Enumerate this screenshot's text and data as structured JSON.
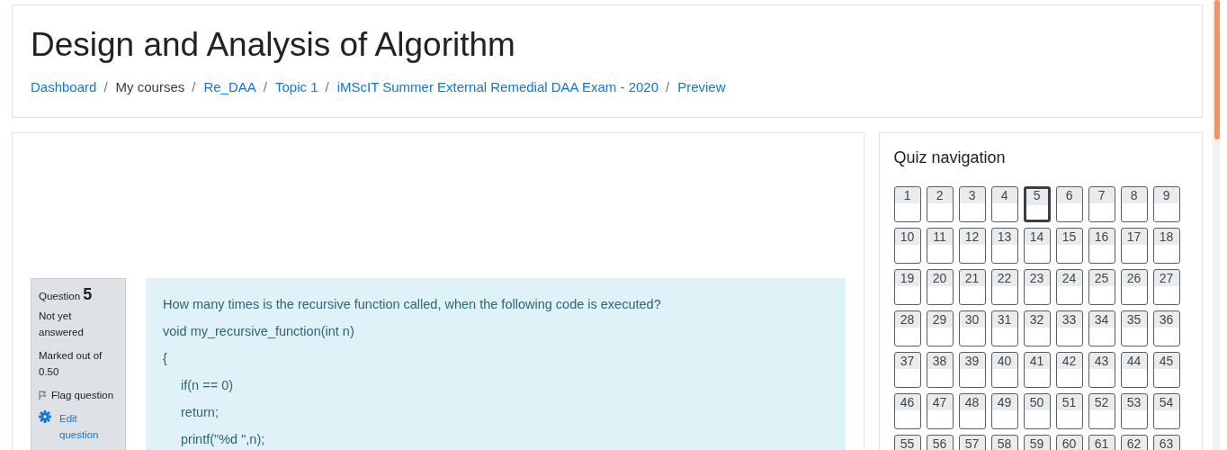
{
  "page_title": "Design and Analysis of Algorithm",
  "breadcrumb": [
    {
      "label": "Dashboard",
      "link": true,
      "separator": "/"
    },
    {
      "label": "My courses",
      "link": false,
      "separator": "/"
    },
    {
      "label": "Re_DAA",
      "link": true,
      "separator": "/"
    },
    {
      "label": "Topic 1",
      "link": true,
      "separator": "/"
    },
    {
      "label": "iMScIT Summer External Remedial DAA Exam - 2020",
      "link": true,
      "separator": "/"
    },
    {
      "label": "Preview",
      "link": true
    }
  ],
  "question_info": {
    "label": "Question",
    "number": "5",
    "state": "Not yet answered",
    "marks": "Marked out of 0.50",
    "flag": "Flag question",
    "edit": "Edit question"
  },
  "question_lines": [
    {
      "text": "How many times is the recursive function called, when the following code is executed?",
      "kind": "prompt"
    },
    {
      "text": "void my_recursive_function(int n)",
      "kind": "code"
    },
    {
      "text": "{",
      "kind": "code"
    },
    {
      "text": "if(n == 0)",
      "kind": "indented"
    },
    {
      "text": "return;",
      "kind": "indented"
    },
    {
      "text": "printf(\"%d \",n);",
      "kind": "indented"
    }
  ],
  "quiz_navigation": {
    "title": "Quiz navigation",
    "buttons": [
      {
        "label": "1",
        "selected": false
      },
      {
        "label": "2",
        "selected": false
      },
      {
        "label": "3",
        "selected": false
      },
      {
        "label": "4",
        "selected": false
      },
      {
        "label": "5",
        "selected": true
      },
      {
        "label": "6",
        "selected": false
      },
      {
        "label": "7",
        "selected": false
      },
      {
        "label": "8",
        "selected": false
      },
      {
        "label": "9",
        "selected": false
      },
      {
        "label": "10",
        "selected": false
      },
      {
        "label": "11",
        "selected": false
      },
      {
        "label": "12",
        "selected": false
      },
      {
        "label": "13",
        "selected": false
      },
      {
        "label": "14",
        "selected": false
      },
      {
        "label": "15",
        "selected": false
      },
      {
        "label": "16",
        "selected": false
      },
      {
        "label": "17",
        "selected": false
      },
      {
        "label": "18",
        "selected": false
      },
      {
        "label": "19",
        "selected": false
      },
      {
        "label": "20",
        "selected": false
      },
      {
        "label": "21",
        "selected": false
      },
      {
        "label": "22",
        "selected": false
      },
      {
        "label": "23",
        "selected": false
      },
      {
        "label": "24",
        "selected": false
      },
      {
        "label": "25",
        "selected": false
      },
      {
        "label": "26",
        "selected": false
      },
      {
        "label": "27",
        "selected": false
      },
      {
        "label": "28",
        "selected": false
      },
      {
        "label": "29",
        "selected": false
      },
      {
        "label": "30",
        "selected": false
      },
      {
        "label": "31",
        "selected": false
      },
      {
        "label": "32",
        "selected": false
      },
      {
        "label": "33",
        "selected": false
      },
      {
        "label": "34",
        "selected": false
      },
      {
        "label": "35",
        "selected": false
      },
      {
        "label": "36",
        "selected": false
      },
      {
        "label": "37",
        "selected": false
      },
      {
        "label": "38",
        "selected": false
      },
      {
        "label": "39",
        "selected": false
      },
      {
        "label": "40",
        "selected": false
      },
      {
        "label": "41",
        "selected": false
      },
      {
        "label": "42",
        "selected": false
      },
      {
        "label": "43",
        "selected": false
      },
      {
        "label": "44",
        "selected": false
      },
      {
        "label": "45",
        "selected": false
      },
      {
        "label": "46",
        "selected": false
      },
      {
        "label": "47",
        "selected": false
      },
      {
        "label": "48",
        "selected": false
      },
      {
        "label": "49",
        "selected": false
      },
      {
        "label": "50",
        "selected": false
      },
      {
        "label": "51",
        "selected": false
      },
      {
        "label": "52",
        "selected": false
      },
      {
        "label": "53",
        "selected": false
      },
      {
        "label": "54",
        "selected": false
      },
      {
        "label": "55",
        "selected": false
      },
      {
        "label": "56",
        "selected": false
      },
      {
        "label": "57",
        "selected": false
      },
      {
        "label": "58",
        "selected": false
      },
      {
        "label": "59",
        "selected": false
      },
      {
        "label": "60",
        "selected": false
      },
      {
        "label": "61",
        "selected": false
      },
      {
        "label": "62",
        "selected": false
      },
      {
        "label": "63",
        "selected": false
      }
    ]
  }
}
